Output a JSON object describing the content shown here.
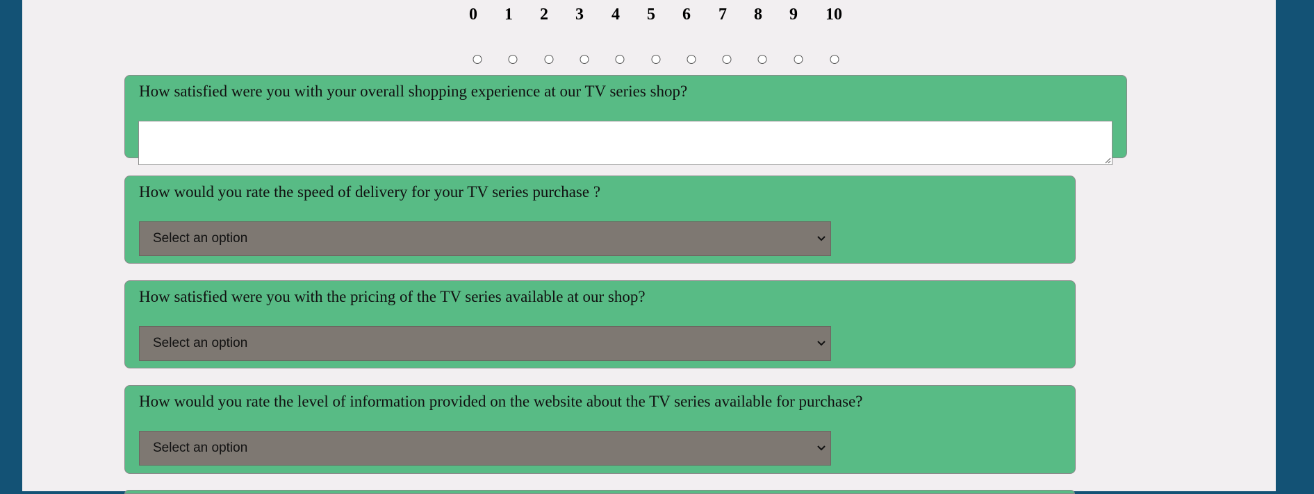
{
  "rating_scale": {
    "labels": [
      "0",
      "1",
      "2",
      "3",
      "4",
      "5",
      "6",
      "7",
      "8",
      "9",
      "10"
    ]
  },
  "questions": [
    {
      "text": "How satisfied were you with your overall shopping experience at our TV series shop?",
      "answer": ""
    },
    {
      "text": "How would you rate the speed of delivery for your TV series purchase ?",
      "selected": "Select an option"
    },
    {
      "text": "How satisfied were you with the pricing of the TV series available at our shop?",
      "selected": "Select an option"
    },
    {
      "text": "How would you rate the level of information provided on the website about the TV series available for purchase?",
      "selected": "Select an option"
    }
  ],
  "colors": {
    "frame": "#135275",
    "page": "#f2eff1",
    "card": "#58bb85",
    "select": "#7e7872"
  }
}
